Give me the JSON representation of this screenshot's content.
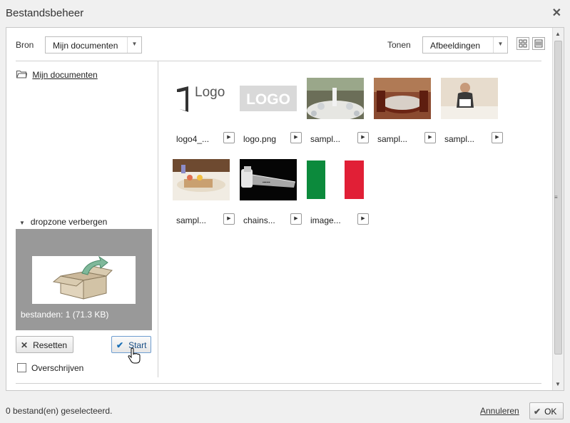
{
  "window": {
    "title": "Bestandsbeheer",
    "close_glyph": "✕"
  },
  "toolbar": {
    "source_label": "Bron",
    "source_value": "Mijn documenten",
    "show_label": "Tonen",
    "show_value": "Afbeeldingen"
  },
  "tree": {
    "root_label": "Mijn documenten"
  },
  "dropzone": {
    "toggle_label": "dropzone verbergen",
    "info": "bestanden: 1 (71.3 KB)",
    "reset_label": "Resetten",
    "start_label": "Start",
    "overwrite_label": "Overschrijven"
  },
  "files": [
    {
      "name": "logo4_...",
      "thumb": "logo-dark"
    },
    {
      "name": "logo.png",
      "thumb": "logo-light"
    },
    {
      "name": "sampl...",
      "thumb": "restaurant-tables"
    },
    {
      "name": "sampl...",
      "thumb": "dining-room"
    },
    {
      "name": "sampl...",
      "thumb": "waitress-bed"
    },
    {
      "name": "sampl...",
      "thumb": "breakfast-bed"
    },
    {
      "name": "chains...",
      "thumb": "chainsaw"
    },
    {
      "name": "image...",
      "thumb": "italian-flag"
    }
  ],
  "thumb_texts": {
    "logo_dark": "Logo",
    "logo_light": "LOGO"
  },
  "status": {
    "selected_text": "0 bestand(en) geselecteerd.",
    "cancel_label": "Annuleren",
    "ok_label": "OK"
  },
  "colors": {
    "flag_green": "#0c8a3c",
    "flag_red": "#e11f36",
    "dropzone_bg": "#999999",
    "check_blue": "#1a6fb5"
  }
}
